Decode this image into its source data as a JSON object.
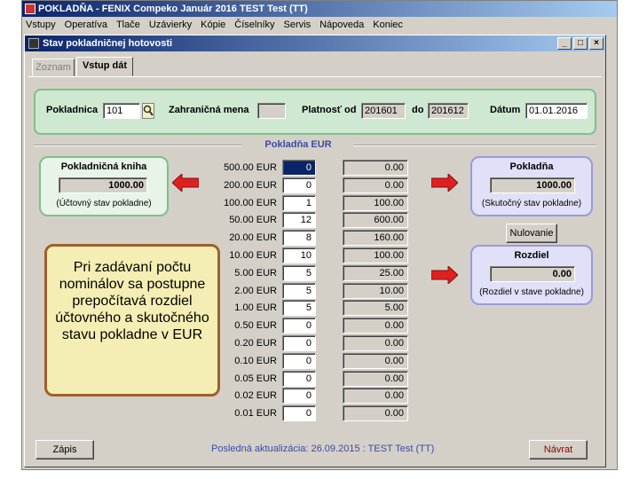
{
  "window": {
    "title": "POKLADŇA - FENIX Compeko  Január 2016  TEST Test  (TT)"
  },
  "menu": [
    "Vstupy",
    "Operatíva",
    "Tlače",
    "Uzávierky",
    "Kópie",
    "Číselníky",
    "Servis",
    "Nápoveda",
    "Koniec"
  ],
  "inner_window": {
    "title": "Stav pokladničnej hotovosti",
    "buttons": [
      "_",
      "□",
      "×"
    ]
  },
  "tabs": {
    "list": "Zoznam",
    "entry": "Vstup dát"
  },
  "header": {
    "cashbox_label": "Pokladnica",
    "cashbox_value": "101",
    "currency_label": "Zahraničná mena",
    "currency_value": "",
    "valid_from_label": "Platnosť od",
    "valid_from_value": "201601",
    "to_label": "do",
    "to_value": "201612",
    "date_label": "Dátum",
    "date_value": "01.01.2016"
  },
  "section_title": "Pokladňa EUR",
  "book": {
    "title": "Pokladničná kniha",
    "value": "1000.00",
    "note": "(Účtovný stav pokladne)"
  },
  "cash": {
    "title": "Pokladňa",
    "value": "1000.00",
    "note": "(Skutočný stav pokladne)"
  },
  "reset_button": "Nulovanie",
  "difference": {
    "title": "Rozdiel",
    "value": "0.00",
    "note": "(Rozdiel v stave pokladne)"
  },
  "tip": "Pri zadávaní počtu nominálov sa postupne prepočítavá rozdiel účtovného a skutočného stavu pokladne v EUR",
  "denominations": [
    {
      "label": "500.00  EUR",
      "count": "0",
      "value": "0.00"
    },
    {
      "label": "200.00  EUR",
      "count": "0",
      "value": "0.00"
    },
    {
      "label": "100.00  EUR",
      "count": "1",
      "value": "100.00"
    },
    {
      "label": "50.00  EUR",
      "count": "12",
      "value": "600.00"
    },
    {
      "label": "20.00  EUR",
      "count": "8",
      "value": "160.00"
    },
    {
      "label": "10.00  EUR",
      "count": "10",
      "value": "100.00"
    },
    {
      "label": "5.00  EUR",
      "count": "5",
      "value": "25.00"
    },
    {
      "label": "2.00  EUR",
      "count": "5",
      "value": "10.00"
    },
    {
      "label": "1.00  EUR",
      "count": "5",
      "value": "5.00"
    },
    {
      "label": "0.50  EUR",
      "count": "0",
      "value": "0.00"
    },
    {
      "label": "0.20  EUR",
      "count": "0",
      "value": "0.00"
    },
    {
      "label": "0.10  EUR",
      "count": "0",
      "value": "0.00"
    },
    {
      "label": "0.05  EUR",
      "count": "0",
      "value": "0.00"
    },
    {
      "label": "0.02  EUR",
      "count": "0",
      "value": "0.00"
    },
    {
      "label": "0.01  EUR",
      "count": "0",
      "value": "0.00"
    }
  ],
  "footer": {
    "save_button": "Zápis",
    "status": "Posledná aktualizácia: 26.09.2015 : TEST Test  (TT)",
    "back_button": "Návrat"
  },
  "colors": {
    "title_bar": "#0a246a",
    "green_panel": "#cfe8d2",
    "blue_panel": "#e0e0f8",
    "tip_bg": "#f5eeb4",
    "arrow": "#e02020"
  },
  "icons": {
    "cashbox_lookup": "search-icon",
    "arrows": "right-arrow-icon"
  }
}
